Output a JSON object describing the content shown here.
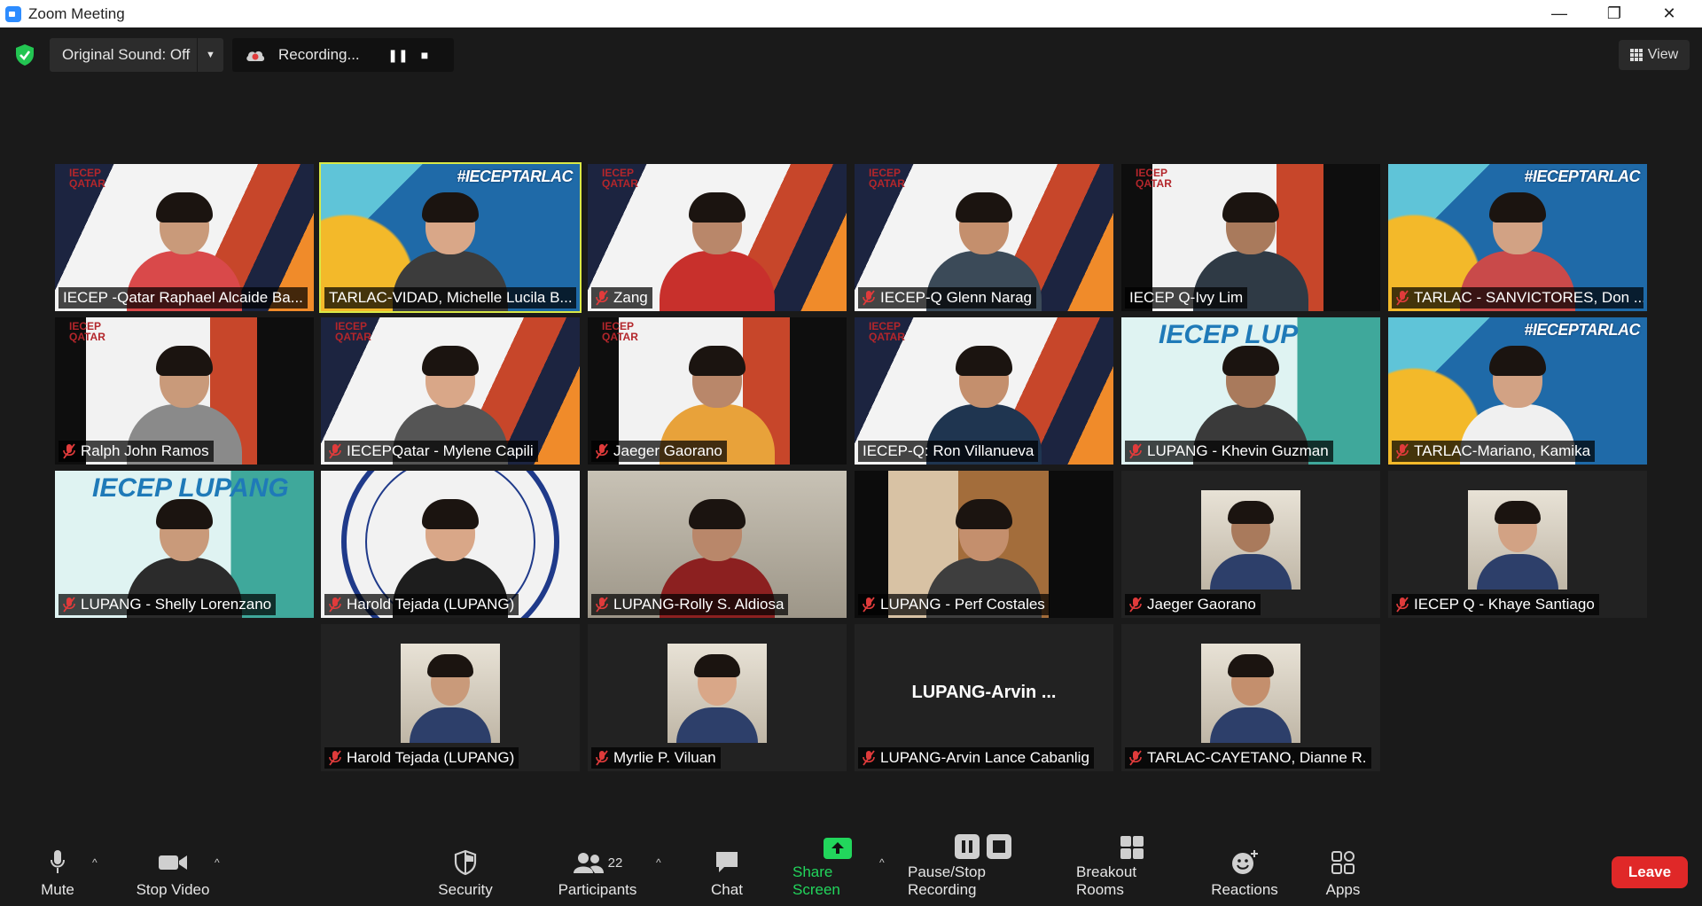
{
  "window": {
    "title": "Zoom Meeting",
    "minimize": "—",
    "maximize": "❐",
    "close": "✕"
  },
  "topbar": {
    "original_sound": "Original Sound: Off",
    "recording_label": "Recording...",
    "view_label": "View"
  },
  "participants": [
    {
      "name": "IECEP -Qatar Raphael Alcaide Ba...",
      "background": "qatar",
      "muted": false,
      "active": false
    },
    {
      "name": "TARLAC-VIDAD, Michelle Lucila B...",
      "background": "tarlac",
      "muted": false,
      "active": true,
      "banner": "#IECEPTARLAC"
    },
    {
      "name": "Zang",
      "background": "qatar",
      "muted": true,
      "active": false
    },
    {
      "name": "IECEP-Q Glenn Narag",
      "background": "qatar",
      "muted": true,
      "active": false
    },
    {
      "name": "IECEP Q-Ivy Lim",
      "background": "black-side",
      "muted": false,
      "active": false
    },
    {
      "name": "TARLAC - SANVICTORES, Don ...",
      "background": "tarlac",
      "muted": true,
      "active": false,
      "banner": "#IECEPTARLAC"
    },
    {
      "name": "Ralph John Ramos",
      "background": "black-side",
      "muted": true,
      "active": false
    },
    {
      "name": "IECEPQatar - Mylene Capili",
      "background": "qatar",
      "muted": true,
      "active": false
    },
    {
      "name": "Jaeger Gaorano",
      "background": "black-side",
      "muted": true,
      "active": false
    },
    {
      "name": "IECEP-Q: Ron Villanueva",
      "background": "qatar",
      "muted": false,
      "active": false
    },
    {
      "name": "LUPANG - Khevin Guzman",
      "background": "lupang",
      "muted": true,
      "active": false,
      "banner": "IECEP LUP"
    },
    {
      "name": "TARLAC-Mariano, Kamika",
      "background": "tarlac",
      "muted": true,
      "active": false,
      "banner": "#IECEPTARLAC"
    },
    {
      "name": "LUPANG - Shelly Lorenzano",
      "background": "lupang",
      "muted": true,
      "active": false,
      "banner": "IECEP LUPANG"
    },
    {
      "name": "Harold Tejada (LUPANG)",
      "background": "seal",
      "muted": true,
      "active": false
    },
    {
      "name": "LUPANG-Rolly S. Aldiosa",
      "background": "room",
      "muted": true,
      "active": false
    },
    {
      "name": "LUPANG - Perf Costales",
      "background": "door",
      "muted": true,
      "active": false
    },
    {
      "name": "Jaeger Gaorano",
      "background": "avatar",
      "muted": true,
      "active": false
    },
    {
      "name": "IECEP Q - Khaye Santiago",
      "background": "avatar",
      "muted": true,
      "active": false
    },
    {
      "name": "Harold Tejada (LUPANG)",
      "background": "avatar",
      "muted": true,
      "active": false
    },
    {
      "name": "Myrlie P. Viluan",
      "background": "avatar",
      "muted": true,
      "active": false
    },
    {
      "name": "LUPANG-Arvin Lance Cabanlig",
      "background": "name-only",
      "muted": true,
      "active": false,
      "display_name": "LUPANG-Arvin ..."
    },
    {
      "name": "TARLAC-CAYETANO, Dianne R.",
      "background": "avatar",
      "muted": true,
      "active": false
    }
  ],
  "toolbar": {
    "mute": "Mute",
    "stop_video": "Stop Video",
    "security": "Security",
    "participants": "Participants",
    "participants_count": "22",
    "chat": "Chat",
    "share_screen": "Share Screen",
    "pause_stop_recording": "Pause/Stop Recording",
    "breakout_rooms": "Breakout Rooms",
    "reactions": "Reactions",
    "apps": "Apps",
    "leave": "Leave"
  },
  "colors": {
    "accent_green": "#22d65c",
    "leave_red": "#e02828",
    "active_speaker": "#d9e847"
  }
}
